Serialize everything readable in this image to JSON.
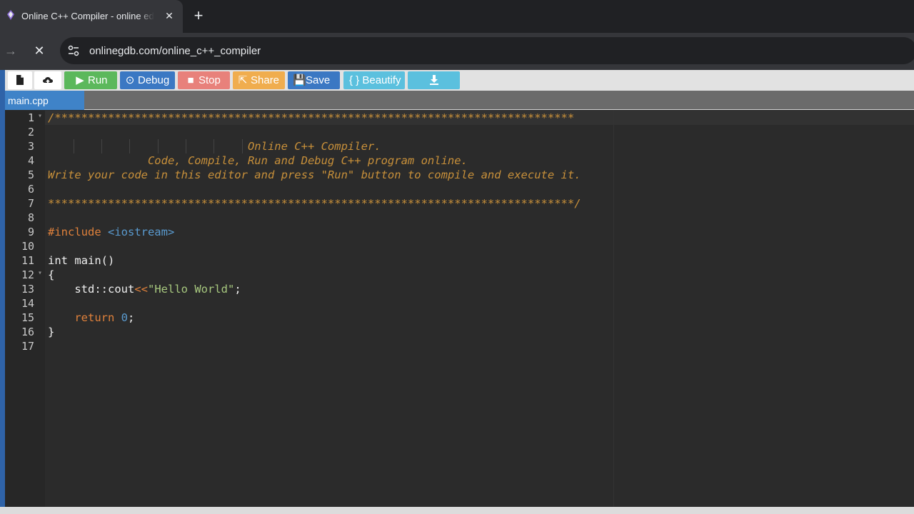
{
  "browser": {
    "tab_title": "Online C++ Compiler - online editor",
    "close_glyph": "✕",
    "new_tab_glyph": "+",
    "forward_glyph": "→",
    "stop_glyph": "✕",
    "url": "onlinegdb.com/online_c++_compiler"
  },
  "toolbar": {
    "new_file_icon": "file-icon",
    "upload_icon": "upload-icon",
    "run_label": "Run",
    "debug_label": "Debug",
    "stop_label": "Stop",
    "share_label": "Share",
    "save_label": "Save",
    "beautify_label": "{ } Beautify",
    "download_icon": "download-icon"
  },
  "file_tab": "main.cpp",
  "editor": {
    "line_numbers": [
      "1",
      "2",
      "3",
      "4",
      "5",
      "6",
      "7",
      "8",
      "9",
      "10",
      "11",
      "12",
      "13",
      "14",
      "15",
      "16",
      "17"
    ],
    "lines": {
      "l1": "/******************************************************************************",
      "l3": "                              Online C++ Compiler.",
      "l4": "               Code, Compile, Run and Debug C++ program online.",
      "l5": "Write your code in this editor and press \"Run\" button to compile and execute it.",
      "l7": "*******************************************************************************/",
      "l9_directive": "#include",
      "l9_header": " <iostream>",
      "l11": "int main()",
      "l12": "{",
      "l13_a": "    std::cout",
      "l13_op": "<<",
      "l13_str": "\"Hello World\"",
      "l13_end": ";",
      "l15_kw": "    return",
      "l15_num": " 0",
      "l15_end": ";",
      "l16": "}"
    }
  },
  "colors": {
    "comment": "#c8903a",
    "keyword": "#e0813b",
    "string": "#a8c97f",
    "number": "#5a9bd0",
    "run": "#5cb85c",
    "debug": "#3b78c3",
    "stop": "#e8817b",
    "share": "#f0ad4e",
    "beautify": "#5bc0de"
  }
}
